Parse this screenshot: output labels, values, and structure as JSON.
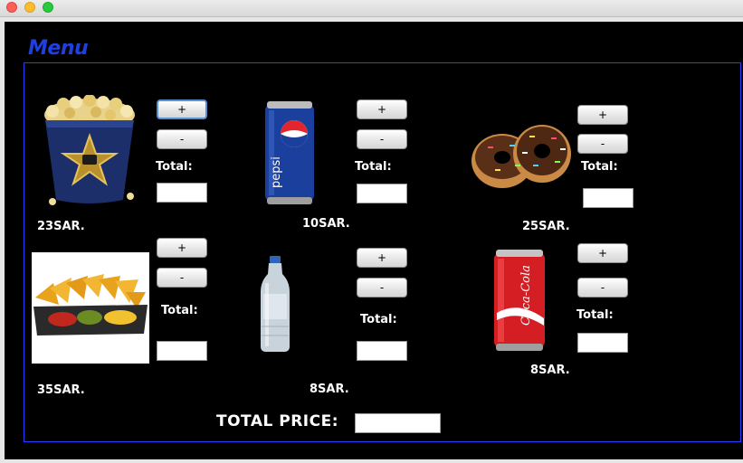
{
  "window": {
    "title": ""
  },
  "menu_title": "Menu",
  "items": [
    {
      "name": "popcorn",
      "price": "23SAR.",
      "plus": "+",
      "minus": "-",
      "total_label": "Total:",
      "total_value": ""
    },
    {
      "name": "pepsi",
      "price": "10SAR.",
      "plus": "+",
      "minus": "-",
      "total_label": "Total:",
      "total_value": "",
      "can_text": "pepsi"
    },
    {
      "name": "donuts",
      "price": "25SAR.",
      "plus": "+",
      "minus": "-",
      "total_label": "Total:",
      "total_value": ""
    },
    {
      "name": "nachos",
      "price": "35SAR.",
      "plus": "+",
      "minus": "-",
      "total_label": "Total:",
      "total_value": ""
    },
    {
      "name": "water",
      "price": "8SAR.",
      "plus": "+",
      "minus": "-",
      "total_label": "Total:",
      "total_value": ""
    },
    {
      "name": "coca-cola",
      "price": "8SAR.",
      "plus": "+",
      "minus": "-",
      "total_label": "Total:",
      "total_value": "",
      "can_text": "Coca-Cola"
    }
  ],
  "total_price_label": "TOTAL PRICE:",
  "total_price_value": "",
  "colors": {
    "background": "#000000",
    "menu_title": "#1f3fe0",
    "panel_border": "#2a3cff"
  }
}
